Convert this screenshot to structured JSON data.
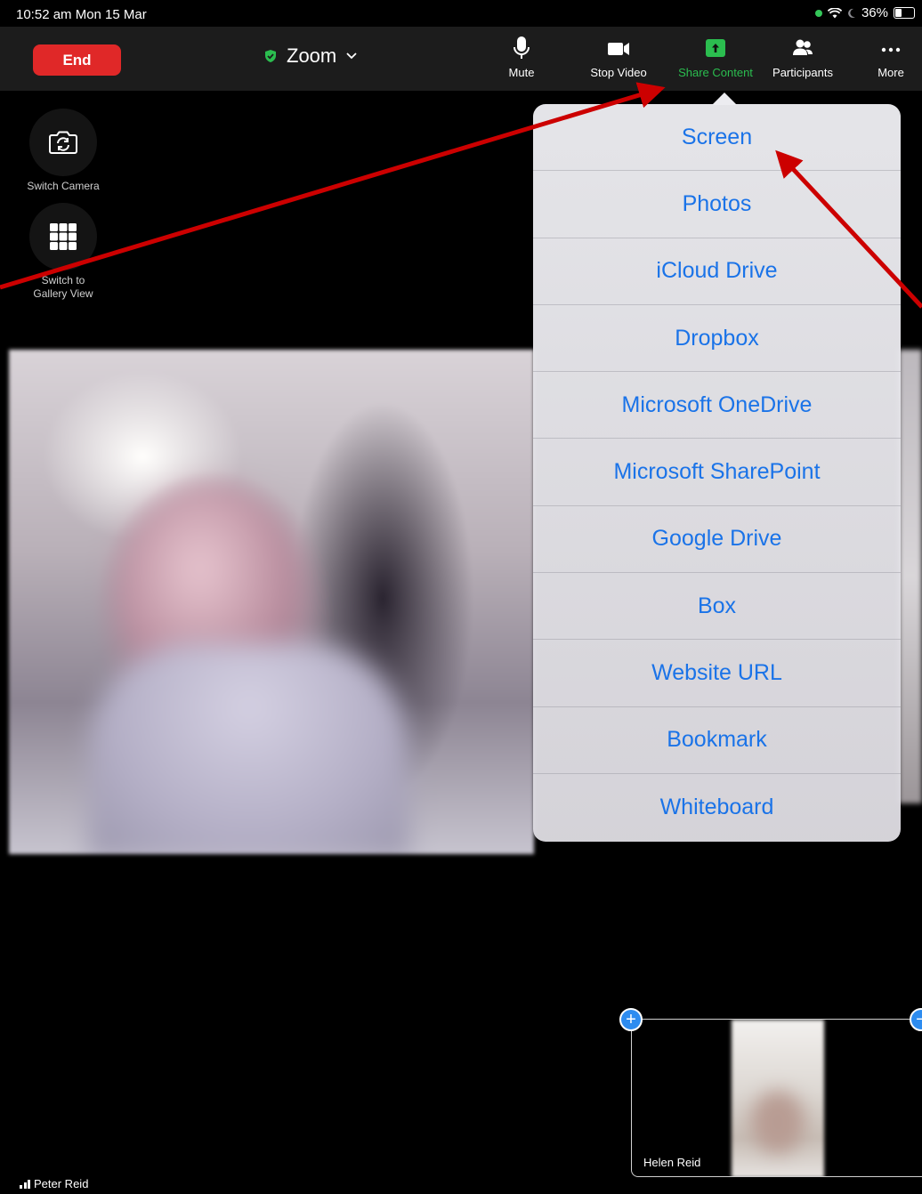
{
  "status_bar": {
    "time": "10:52 am  Mon 15 Mar",
    "battery": "36%"
  },
  "toolbar": {
    "end_label": "End",
    "meeting_title": "Zoom",
    "buttons": [
      {
        "label": "Mute",
        "icon": "microphone-icon"
      },
      {
        "label": "Stop Video",
        "icon": "video-camera-icon"
      },
      {
        "label": "Share Content",
        "icon": "share-screen-icon"
      },
      {
        "label": "Participants",
        "icon": "participants-icon"
      },
      {
        "label": "More",
        "icon": "more-ellipsis-icon"
      }
    ],
    "active_color": "#2bbd4f",
    "end_color": "#e02828"
  },
  "side_controls": {
    "switch_camera_label": "Switch Camera",
    "gallery_line1": "Switch to",
    "gallery_line2": "Gallery View"
  },
  "share_menu": {
    "items": [
      "Screen",
      "Photos",
      "iCloud Drive",
      "Dropbox",
      "Microsoft OneDrive",
      "Microsoft SharePoint",
      "Google Drive",
      "Box",
      "Website URL",
      "Bookmark",
      "Whiteboard"
    ],
    "link_color": "#1a73e8"
  },
  "thumbnail": {
    "name": "Helen Reid"
  },
  "active_speaker": {
    "name": "Peter Reid"
  },
  "annotation_color": "#cc0000"
}
